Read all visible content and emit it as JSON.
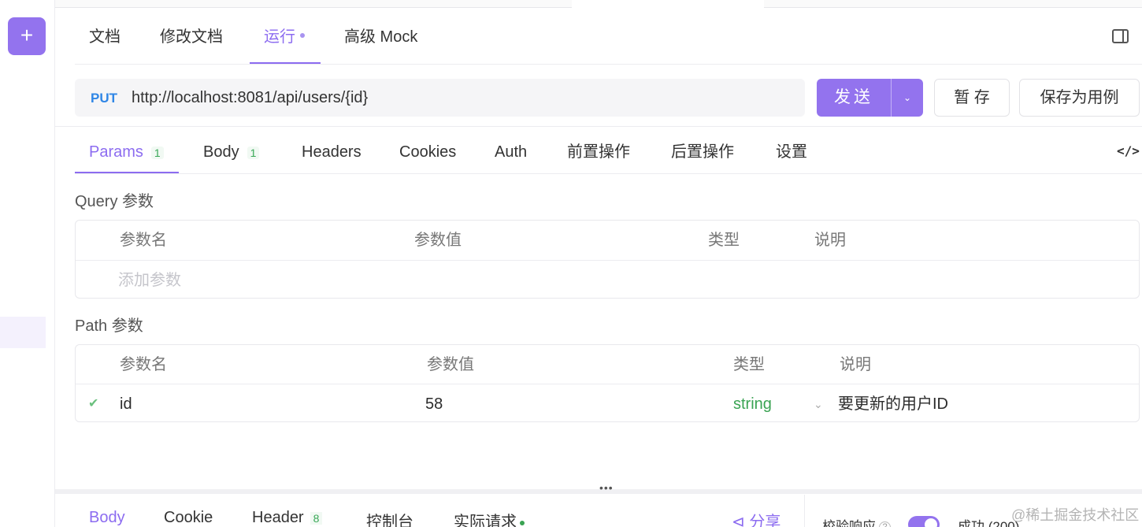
{
  "rail": {
    "add_label": "+"
  },
  "main_tabs": [
    {
      "label": "文档"
    },
    {
      "label": "修改文档"
    },
    {
      "label": "运行"
    },
    {
      "label": "高级 Mock"
    }
  ],
  "request": {
    "method": "PUT",
    "url": "http://localhost:8081/api/users/{id}",
    "send_label": "发送",
    "send_dropdown_icon": "chevron-down",
    "save_temp_label": "暂 存",
    "save_case_label": "保存为用例"
  },
  "param_tabs": [
    {
      "label": "Params",
      "badge": "1"
    },
    {
      "label": "Body",
      "badge": "1"
    },
    {
      "label": "Headers"
    },
    {
      "label": "Cookies"
    },
    {
      "label": "Auth"
    },
    {
      "label": "前置操作"
    },
    {
      "label": "后置操作"
    },
    {
      "label": "设置"
    }
  ],
  "code_icon": "</>",
  "query": {
    "title": "Query 参数",
    "headers": [
      "参数名",
      "参数值",
      "类型",
      "说明"
    ],
    "placeholder": "添加参数"
  },
  "path": {
    "title": "Path 参数",
    "headers": [
      "参数名",
      "参数值",
      "类型",
      "说明"
    ],
    "rows": [
      {
        "checked": true,
        "name": "id",
        "value": "58",
        "type": "string",
        "desc": "要更新的用户ID"
      }
    ]
  },
  "bottom_tabs": [
    {
      "label": "Body"
    },
    {
      "label": "Cookie"
    },
    {
      "label": "Header",
      "badge": "8"
    },
    {
      "label": "控制台"
    },
    {
      "label": "实际请求"
    }
  ],
  "share_label": "分享",
  "validate_label": "校验响应",
  "success_label": "成功 (200)",
  "watermark": "@稀土掘金技术社区",
  "colors": {
    "accent": "#9373ee",
    "method": "#2f86e6",
    "type": "#3aa353"
  }
}
